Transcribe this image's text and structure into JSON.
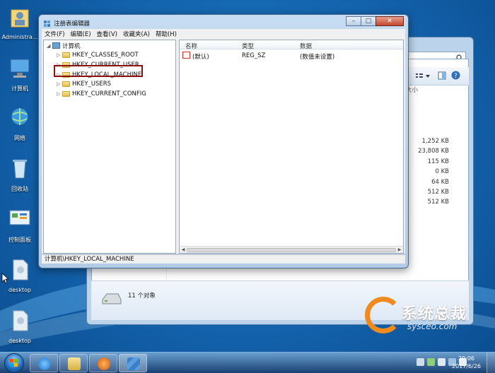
{
  "desktop": {
    "icons": [
      {
        "label": "Administra..."
      },
      {
        "label": "计算机"
      },
      {
        "label": "网络"
      },
      {
        "label": "回收站"
      },
      {
        "label": "控制面板"
      },
      {
        "label": "desktop"
      },
      {
        "label": "desktop"
      }
    ]
  },
  "explorer": {
    "column_header": "大小",
    "sizes": [
      "1,252 KB",
      "23,808 KB",
      "115 KB",
      "0 KB",
      "64 KB",
      "512 KB",
      "512 KB"
    ],
    "status_count": "11 个对象"
  },
  "regedit": {
    "title": "注册表编辑器",
    "menu": [
      "文件(F)",
      "编辑(E)",
      "查看(V)",
      "收藏夹(A)",
      "帮助(H)"
    ],
    "tree": {
      "root": "计算机",
      "nodes": [
        "HKEY_CLASSES_ROOT",
        "HKEY_CURRENT_USER",
        "HKEY_LOCAL_MACHINE",
        "HKEY_USERS",
        "HKEY_CURRENT_CONFIG"
      ]
    },
    "values": {
      "headers": {
        "name": "名称",
        "type": "类型",
        "data": "数据"
      },
      "row": {
        "name": "(默认)",
        "type": "REG_SZ",
        "data": "(数值未设置)"
      }
    },
    "status_path": "计算机\\HKEY_LOCAL_MACHINE",
    "window_buttons": {
      "min": "–",
      "max": "□",
      "close": "✕"
    },
    "value_icon": "ab"
  },
  "taskbar": {
    "time": "20:06",
    "date": "2017/6/26"
  },
  "watermark": {
    "brand": "系统总裁",
    "site": "sysceo.com"
  }
}
